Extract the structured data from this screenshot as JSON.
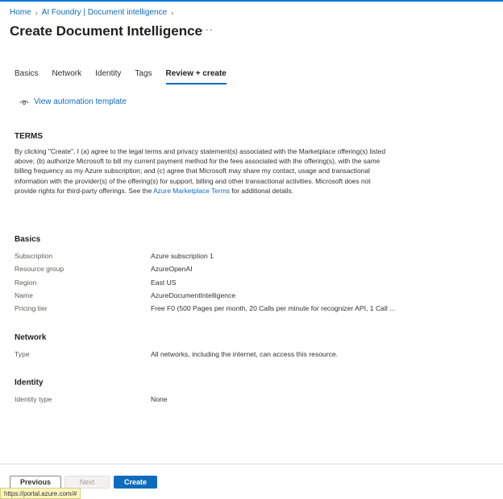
{
  "breadcrumb": {
    "items": [
      "Home",
      "AI Foundry | Document intelligence"
    ]
  },
  "header": {
    "title": "Create Document Intelligence",
    "more_label": "···"
  },
  "tabs": [
    {
      "label": "Basics"
    },
    {
      "label": "Network"
    },
    {
      "label": "Identity"
    },
    {
      "label": "Tags"
    },
    {
      "label": "Review + create"
    }
  ],
  "active_tab": "Review + create",
  "automation": {
    "label": "View automation template",
    "icon": "eye-icon"
  },
  "terms": {
    "title": "TERMS",
    "text_before": "By clicking \"Create\", I (a) agree to the legal terms and privacy statement(s) associated with the Marketplace offering(s) listed above; (b) authorize Microsoft to bill my current payment method for the fees associated with the offering(s), with the same billing frequency as my Azure subscription; and (c) agree that Microsoft may share my contact, usage and transactional information with the provider(s) of the offering(s) for support, billing and other transactional activities. Microsoft does not provide rights for third-party offerings. See the ",
    "link": "Azure Marketplace Terms",
    "text_after": " for additional details."
  },
  "basics": {
    "title": "Basics",
    "rows": [
      {
        "label": "Subscription",
        "value": "Azure subscription 1"
      },
      {
        "label": "Resource group",
        "value": "AzureOpenAI"
      },
      {
        "label": "Region",
        "value": "East US"
      },
      {
        "label": "Name",
        "value": "AzureDocumentIntelligence"
      },
      {
        "label": "Pricing tier",
        "value": "Free F0 (500 Pages per month, 20 Calls per minute for recognizer API, 1 Call ..."
      }
    ]
  },
  "network": {
    "title": "Network",
    "rows": [
      {
        "label": "Type",
        "value": "All networks, including the internet, can access this resource."
      }
    ]
  },
  "identity": {
    "title": "Identity",
    "rows": [
      {
        "label": "Identity type",
        "value": "None"
      }
    ]
  },
  "footer": {
    "previous_label": "Previous",
    "next_label": "Next",
    "create_label": "Create"
  },
  "status_bar": {
    "url": "https://portal.azure.com/#"
  },
  "colors": {
    "accent": "#0f6cbd",
    "text": "#323130",
    "muted": "#605e5c"
  }
}
